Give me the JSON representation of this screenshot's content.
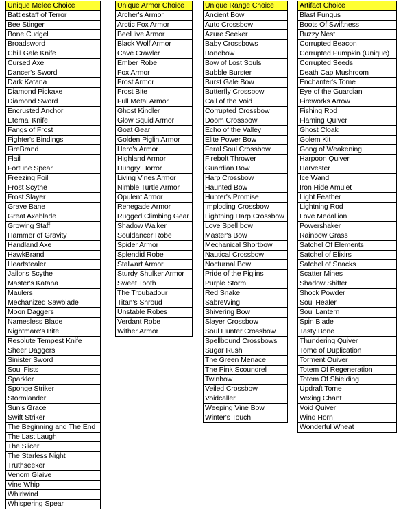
{
  "columns": [
    {
      "header": "Unique Melee Choice",
      "items": [
        "Battlestaff of Terror",
        "Bee Stinger",
        "Bone Cudgel",
        "Broadsword",
        "Chill Gale Knife",
        "Cursed Axe",
        "Dancer's Sword",
        "Dark Katana",
        "Diamond Pickaxe",
        "Diamond Sword",
        "Encrusted Anchor",
        "Eternal Knife",
        "Fangs of Frost",
        "Fighter's Bindings",
        "FireBrand",
        "Flail",
        "Fortune Spear",
        "Freezing Foil",
        "Frost Scythe",
        "Frost Slayer",
        "Grave Bane",
        "Great Axeblade",
        "Growing Staff",
        "Hammer of Gravity",
        "Handland Axe",
        "HawkBrand",
        "Heartstealer",
        "Jailor's Scythe",
        "Master's Katana",
        "Maulers",
        "Mechanized Sawblade",
        "Moon Daggers",
        "Namesless Blade",
        "Nightmare's Bite",
        "Resolute Tempest Knife",
        "Sheer Daggers",
        "Sinister Sword",
        "Soul Fists",
        "Sparkler",
        "Sponge Striker",
        "Stormlander",
        "Sun's Grace",
        "Swift Striker",
        "The Beginning and The End",
        "The Last Laugh",
        "The Slicer",
        "The Starless Night",
        "Truthseeker",
        "Venom Glaive",
        "Vine Whip",
        "Whirlwind",
        "Whispering Spear"
      ]
    },
    {
      "header": "Unique Armor Choice",
      "items": [
        "Archer's Armor",
        "Arctic Fox Armor",
        "BeeHive Armor",
        "Black Wolf Armor",
        "Cave Crawler",
        "Ember Robe",
        "Fox Armor",
        "Frost Armor",
        "Frost Bite",
        "Full Metal Armor",
        "Ghost Kindler",
        "Glow Squid Armor",
        "Goat Gear",
        "Golden Piglin Armor",
        "Hero's Armor",
        "Highland Armor",
        "Hungry Horror",
        "Living Vines Armor",
        "Nimble Turtle Armor",
        "Opulent Armor",
        "Renegade Armor",
        "Rugged Climbing Gear",
        "Shadow Walker",
        "Souldancer Robe",
        "Spider Armor",
        "Splendid Robe",
        "Stalwart Armor",
        "Sturdy Shulker Armor",
        "Sweet Tooth",
        "The Troubadour",
        "Titan's Shroud",
        "Unstable Robes",
        "Verdant Robe",
        "Wither Armor"
      ]
    },
    {
      "header": "Unique Range Choice",
      "items": [
        "Ancient Bow",
        "Auto Crossbow",
        "Azure Seeker",
        "Baby Crossbows",
        "Bonebow",
        "Bow of Lost Souls",
        "Bubble Burster",
        "Burst Gale Bow",
        "Butterfly Crossbow",
        "Call of the Void",
        "Corrupted Crossbow",
        "Doom Crossbow",
        "Echo of the Valley",
        "Elite Power Bow",
        "Feral Soul Crossbow",
        "Firebolt Thrower",
        "Guardian Bow",
        "Harp Crossbow",
        "Haunted Bow",
        "Hunter's Promise",
        "Imploding Crossbow",
        "Lightning Harp Crossbow",
        "Love Spell bow",
        "Master's Bow",
        "Mechanical Shortbow",
        "Nautical Crossbow",
        "Nocturnal Bow",
        "Pride of the Piglins",
        "Purple Storm",
        "Red Snake",
        "SabreWing",
        "Shivering Bow",
        "Slayer Crossbow",
        "Soul Hunter Crossbow",
        "Spellbound Crossbows",
        "Sugar Rush",
        "The Green Menace",
        "The Pink Scoundrel",
        "Twinbow",
        "Veiled Crossbow",
        "Voidcaller",
        "Weeping Vine Bow",
        "Winter's Touch"
      ]
    },
    {
      "header": "Artifact Choice",
      "items": [
        "Blast Fungus",
        "Boots Of Swiftness",
        "Buzzy Nest",
        "Corrupted Beacon",
        "Corrupted Pumpkin (Unique)",
        "Corrupted Seeds",
        "Death Cap Mushroom",
        "Enchanter's Tome",
        "Eye of the Guardian",
        "Fireworks Arrow",
        "Fishing Rod",
        "Flaming Quiver",
        "Ghost Cloak",
        "Golem Kit",
        "Gong of Weakening",
        "Harpoon Quiver",
        "Harvester",
        "Ice Wand",
        "Iron Hide Amulet",
        "Light Feather",
        "Lightning Rod",
        "Love Medallion",
        "Powershaker",
        "Rainbow Grass",
        "Satchel Of Elements",
        "Satchel of Elixirs",
        "Satchel of Snacks",
        "Scatter Mines",
        "Shadow Shifter",
        "Shock Powder",
        "Soul Healer",
        "Soul Lantern",
        "Spin Blade",
        "Tasty Bone",
        "Thundering Quiver",
        "Tome of Duplication",
        "Torment Quiver",
        "Totem Of Regeneration",
        "Totem Of Shielding",
        "Updraft Tome",
        "Vexing Chant",
        "Void Quiver",
        "Wind Horn",
        "Wonderful Wheat"
      ]
    }
  ],
  "colors": {
    "header_bg": "#ffff33",
    "border": "#000000",
    "cell_bg": "#ffffff"
  }
}
